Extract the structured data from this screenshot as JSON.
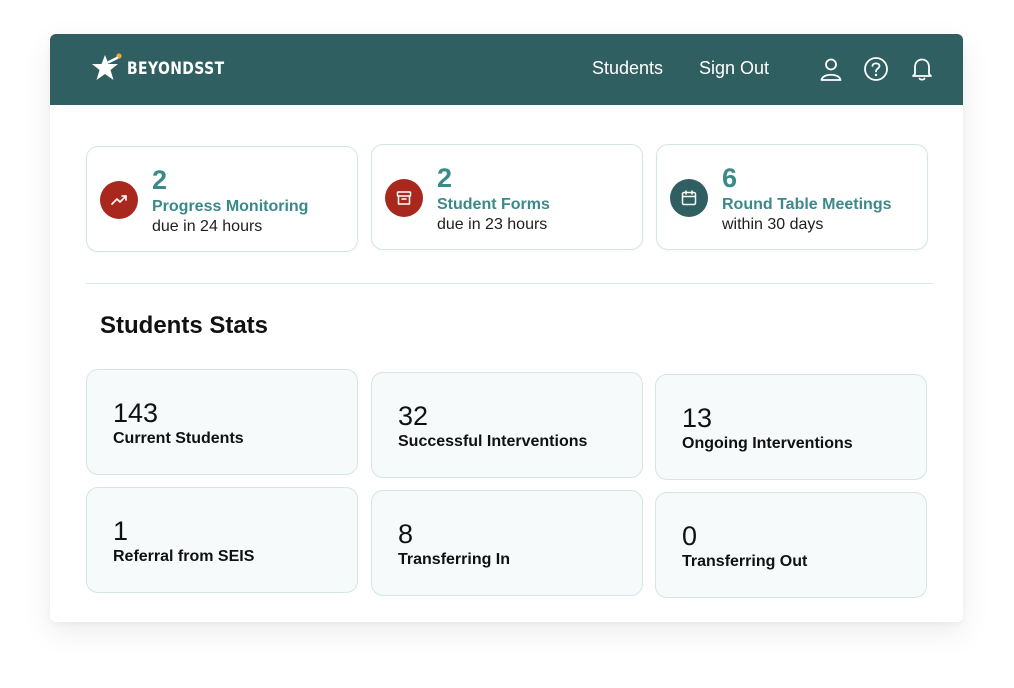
{
  "header": {
    "brand": "BEYONDSST",
    "nav": [
      {
        "label": "Students"
      },
      {
        "label": "Sign Out"
      }
    ],
    "icons": [
      "user-icon",
      "help-icon",
      "bell-icon"
    ],
    "bg_color": "#2f5f61"
  },
  "alerts": [
    {
      "count": "2",
      "title": "Progress Monitoring",
      "subtitle": "due in 24 hours",
      "icon": "trending-up-icon",
      "color": "#a8281d"
    },
    {
      "count": "2",
      "title": "Student Forms",
      "subtitle": "due in 23 hours",
      "icon": "archive-box-icon",
      "color": "#a8281d"
    },
    {
      "count": "6",
      "title": "Round Table Meetings",
      "subtitle": "within 30 days",
      "icon": "calendar-icon",
      "color": "#2f5f61"
    }
  ],
  "stats": {
    "title": "Students Stats",
    "cards": [
      {
        "value": "143",
        "label": "Current Students"
      },
      {
        "value": "32",
        "label": "Successful Interventions"
      },
      {
        "value": "13",
        "label": "Ongoing Interventions"
      },
      {
        "value": "1",
        "label": "Referral from SEIS"
      },
      {
        "value": "8",
        "label": "Transferring In"
      },
      {
        "value": "0",
        "label": "Transferring Out"
      }
    ]
  }
}
